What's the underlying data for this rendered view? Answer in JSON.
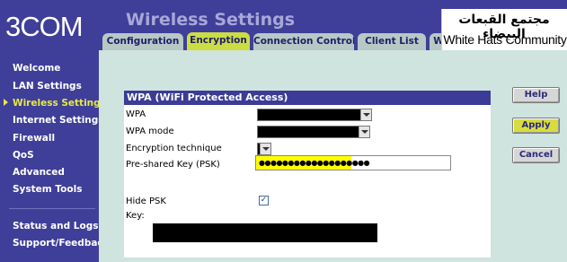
{
  "header": {
    "logo": "3COM",
    "title": "Wireless Settings"
  },
  "tabs": [
    {
      "label": "Configuration",
      "active": false
    },
    {
      "label": "Encryption",
      "active": true
    },
    {
      "label": "Connection Control",
      "active": false
    },
    {
      "label": "Client List",
      "active": false
    },
    {
      "label": "W",
      "active": false
    }
  ],
  "watermark": {
    "arabic": "مجتمع القبعات البيضاء",
    "english": "White Hats Community"
  },
  "sidebar": {
    "items": [
      {
        "label": "Welcome",
        "active": false
      },
      {
        "label": "LAN Settings",
        "active": false
      },
      {
        "label": "Wireless Settings",
        "active": true
      },
      {
        "label": "Internet Settings",
        "active": false
      },
      {
        "label": "Firewall",
        "active": false
      },
      {
        "label": "QoS",
        "active": false
      },
      {
        "label": "Advanced",
        "active": false
      },
      {
        "label": "System Tools",
        "active": false
      },
      {
        "label": "Status and Logs",
        "active": false
      },
      {
        "label": "Support/Feedback",
        "active": false
      }
    ]
  },
  "panel": {
    "title": "WPA (WiFi Protected Access)",
    "fields": {
      "wpa_label": "WPA",
      "wpa_mode_label": "WPA mode",
      "encryption_label": "Encryption technique",
      "psk_label": "Pre-shared Key (PSK)",
      "psk_value": "●●●●●●●●●●●●●●●●●●●",
      "hide_psk_label": "Hide PSK",
      "hide_psk_checked_mark": "✓",
      "key_label": "Key:"
    }
  },
  "buttons": {
    "help": "Help",
    "apply": "Apply",
    "cancel": "Cancel"
  },
  "colors": {
    "brand_blue": "#3f3f99",
    "accent_yellow": "#ccdd44",
    "content_bg": "#cfe3df",
    "active_nav": "#e8e84a"
  }
}
